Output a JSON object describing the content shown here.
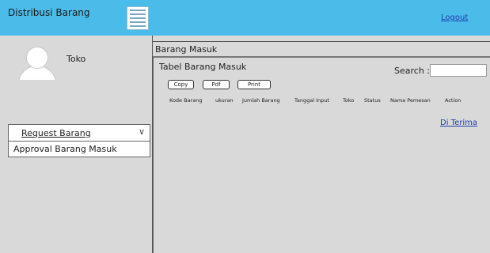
{
  "header": {
    "app_title": "Distribusi Barang",
    "logout_label": "Logout"
  },
  "sidebar": {
    "role_label": "Toko",
    "dropdown": {
      "selected": "Request Barang"
    },
    "menu_items": [
      "Approval Barang Masuk"
    ]
  },
  "main": {
    "panel_title": "Barang Masuk",
    "table_title": "Tabel Barang Masuk",
    "search": {
      "label": "Search :",
      "value": ""
    },
    "buttons": {
      "copy": "Copy",
      "pdf": "Pdf",
      "print": "Print"
    },
    "table": {
      "columns": [
        "Kode Barang",
        "ukuran",
        "Jumlah Barang",
        "Tanggal Input",
        "Toko",
        "Status",
        "Nama Pemesan",
        "Action"
      ],
      "rows": [
        {
          "action": "Di Terima"
        }
      ]
    }
  },
  "colors": {
    "header": "#4bbbe9",
    "panel_bg": "#d9d9d9",
    "link": "#1f3fae"
  }
}
